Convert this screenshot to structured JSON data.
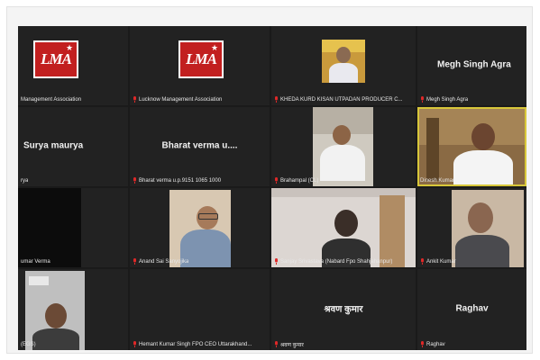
{
  "tiles": [
    {
      "name": "Management Association",
      "display": "",
      "logo": "LMA"
    },
    {
      "name": "Lucknow Management Association",
      "display": "",
      "logo": "LMA"
    },
    {
      "name": "KHEDA KURD KISAN UTPADAN PRODUCER C...",
      "display": ""
    },
    {
      "name": "Megh Singh Agra",
      "display": "Megh Singh Agra"
    },
    {
      "name": "rya",
      "display": "Surya maurya"
    },
    {
      "name": "Bharat verma u.p.9151 1065 1000",
      "display": "Bharat verma u...."
    },
    {
      "name": "Brahampal (CL)",
      "display": ""
    },
    {
      "name": "Dinesh Kumar",
      "display": ""
    },
    {
      "name": "umar Verma",
      "display": ""
    },
    {
      "name": "Anand Sai Sanyojika",
      "display": ""
    },
    {
      "name": "Sanjay Srivastava (Nabard Fpo Shahjahanpur)",
      "display": ""
    },
    {
      "name": "Ankit Kumar",
      "display": ""
    },
    {
      "name": "(EGS)",
      "display": ""
    },
    {
      "name": "Hemant Kumar Singh FPO CEO Uttarakhand...",
      "display": ""
    },
    {
      "name": "श्रवण कुमार",
      "display": "श्रवण कुमार"
    },
    {
      "name": "Raghav",
      "display": "Raghav"
    }
  ],
  "colors": {
    "grid_bg": "#1a1a1a",
    "tile_bg": "#222222",
    "active_border": "#d8c73a",
    "muted_mic": "#e02828"
  },
  "icons": {
    "mic": "microphone-muted-icon"
  }
}
